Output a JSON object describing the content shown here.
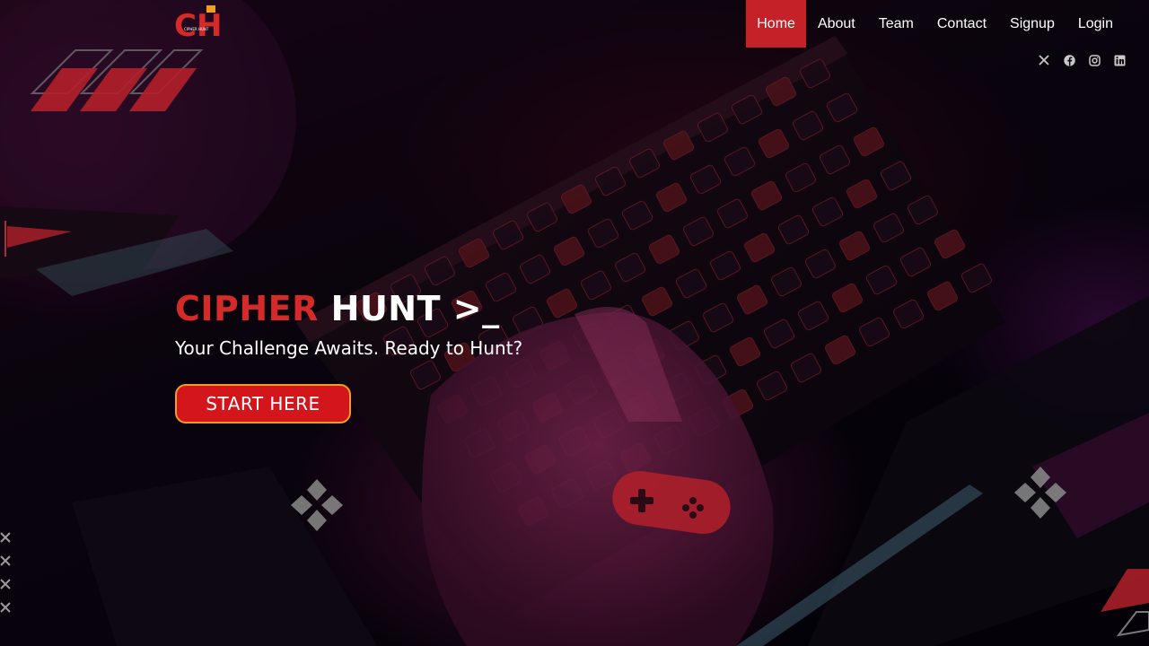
{
  "brand": {
    "logo_text": "CH",
    "logo_subtext": "CIPHER HUNT",
    "accent_color": "#c42128"
  },
  "nav": {
    "items": [
      {
        "label": "Home",
        "active": true
      },
      {
        "label": "About",
        "active": false
      },
      {
        "label": "Team",
        "active": false
      },
      {
        "label": "Contact",
        "active": false
      },
      {
        "label": "Signup",
        "active": false
      },
      {
        "label": "Login",
        "active": false
      }
    ]
  },
  "socials": [
    "x-icon",
    "facebook-icon",
    "instagram-icon",
    "linkedin-icon"
  ],
  "hero": {
    "title_accent": "CIPHER",
    "title_rest": "HUNT >_",
    "subtitle": "Your Challenge Awaits. Ready to Hunt?",
    "cta_label": "START HERE",
    "cta_bg": "#d2161b",
    "cta_border": "#f0a020"
  }
}
